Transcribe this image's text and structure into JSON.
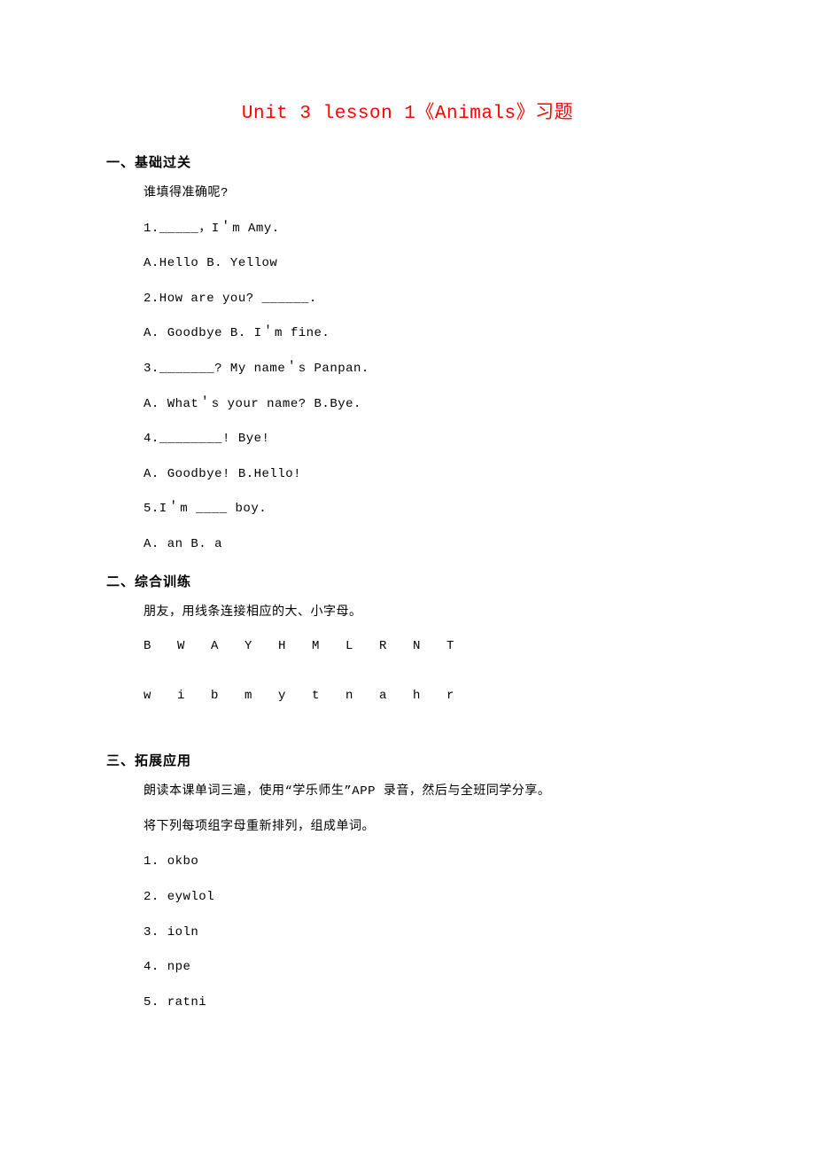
{
  "title": "Unit 3 lesson 1《Animals》习题",
  "section1": {
    "header": "一、基础过关",
    "intro": "谁填得准确呢?",
    "q1": "1._____，I＇m Amy.",
    "q1opts": "A.Hello B. Yellow",
    "q2": "2.How are you? ______.",
    "q2opts": "A. Goodbye B. I＇m fine.",
    "q3": "3._______? My name＇s Panpan.",
    "q3opts": "A. What＇s your name? B.Bye.",
    "q4": "4.________! Bye!",
    "q4opts": "A. Goodbye! B.Hello!",
    "q5": "5.I＇m ____ boy.",
    "q5opts": "A. an B. a"
  },
  "section2": {
    "header": "二、综合训练",
    "intro": "朋友，用线条连接相应的大、小字母。",
    "upper": [
      "B",
      "W",
      "A",
      "Y",
      "H",
      "M",
      "L",
      "R",
      "N",
      "T"
    ],
    "lower": [
      "w",
      "i",
      "b",
      "m",
      "y",
      "t",
      "n",
      "a",
      "h",
      "r"
    ]
  },
  "section3": {
    "header": "三、拓展应用",
    "intro1": "朗读本课单词三遍，使用“学乐师生”APP 录音，然后与全班同学分享。",
    "intro2": "将下列每项组字母重新排列，组成单词。",
    "items": [
      "1. okbo",
      "2. eywlol",
      "3. ioln",
      "4. npe",
      "5. ratni"
    ]
  }
}
